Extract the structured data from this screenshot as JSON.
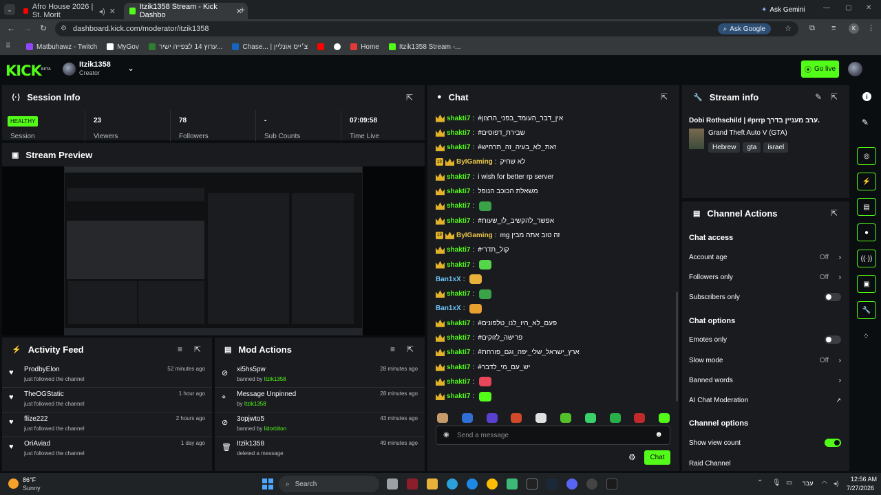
{
  "browser": {
    "tabs": [
      {
        "title": "Afro House 2026 | St. Morit"
      },
      {
        "title": "Itzik1358 Stream - Kick Dashbo"
      }
    ],
    "ask_gemini": "Ask Gemini",
    "url": "dashboard.kick.com/moderator/itzik1358",
    "ask_google": "Ask Google",
    "bookmarks": [
      {
        "label": "Matbuhawz - Twitch",
        "color": "#9146ff"
      },
      {
        "label": "MyGov",
        "color": ""
      },
      {
        "label": "ערוץ 14 לצפייה ישיר...",
        "color": "#2e7d32"
      },
      {
        "label": "Chase... | צ׳ייס אונליין",
        "color": "#1565c0"
      },
      {
        "label": "",
        "color": "#ff0000"
      },
      {
        "label": "",
        "color": "#ffffff"
      },
      {
        "label": "Home",
        "color": "#e53935"
      },
      {
        "label": "Itzik1358 Stream -...",
        "color": "#53fc18"
      }
    ],
    "profile_initial": "K"
  },
  "header": {
    "logo": "KICK",
    "logo_beta": "BETA",
    "channel_name": "Itzik1358",
    "role": "Creator",
    "go_live": "Go live"
  },
  "session": {
    "title": "Session Info",
    "health": "HEALTHY",
    "health_label": "Session",
    "stats": [
      {
        "value": "23",
        "label": "Viewers"
      },
      {
        "value": "78",
        "label": "Followers"
      },
      {
        "value": "-",
        "label": "Sub Counts"
      },
      {
        "value": "07:09:58",
        "label": "Time Live"
      }
    ]
  },
  "preview": {
    "title": "Stream Preview"
  },
  "activity": {
    "title": "Activity Feed",
    "items": [
      {
        "name": "ProdbyElon",
        "sub": "just followed the channel",
        "time": "52 minutes ago"
      },
      {
        "name": "TheOGStatic",
        "sub": "just followed the channel",
        "time": "1 hour ago"
      },
      {
        "name": "flize222",
        "sub": "just followed the channel",
        "time": "2 hours ago"
      },
      {
        "name": "OriAviad",
        "sub": "just followed the channel",
        "time": "1 day ago"
      }
    ]
  },
  "mod_actions": {
    "title": "Mod Actions",
    "items": [
      {
        "name": "xi5hs5pw",
        "sub_prefix": "banned by",
        "by": "Itzik1358",
        "time": "28 minutes ago",
        "icon": "ban-icon"
      },
      {
        "name": "Message Unpinned",
        "sub_prefix": "by",
        "by": "Itzik1358",
        "time": "28 minutes ago",
        "icon": "unpin-icon"
      },
      {
        "name": "3opjwto5",
        "sub_prefix": "banned by",
        "by": "lidorbiton",
        "time": "43 minutes ago",
        "icon": "ban-icon"
      },
      {
        "name": "Itzik1358",
        "sub_prefix": "deleted a message",
        "by": "",
        "time": "49 minutes ago",
        "icon": "trash-icon"
      }
    ]
  },
  "chat": {
    "title": "Chat",
    "messages": [
      {
        "user": "shakti7",
        "text": "#אין_דבר_העומד_בפני_הרצון",
        "kind": "crown",
        "color": "g"
      },
      {
        "user": "shakti7",
        "text": "#שבירת_דפוסים",
        "kind": "crown",
        "color": "g"
      },
      {
        "user": "shakti7",
        "text": "#זאת_לא_בעיה_זה_תרחיש",
        "kind": "crown",
        "color": "g"
      },
      {
        "user": "ByIGaming",
        "text": "לא שחיק",
        "kind": "sub",
        "color": "y"
      },
      {
        "user": "shakti7",
        "text": "i wish for better rp server",
        "kind": "crown",
        "color": "g"
      },
      {
        "user": "shakti7",
        "text": "משאלת הכוכב הנופל",
        "kind": "crown",
        "color": "g"
      },
      {
        "user": "shakti7",
        "text": "",
        "kind": "crown",
        "color": "g",
        "emote": "#3aa34a"
      },
      {
        "user": "shakti7",
        "text": "#אפשר_להקשיב_לו_שעות",
        "kind": "crown",
        "color": "g"
      },
      {
        "user": "ByIGaming",
        "text": "mg זה טוב אתה מבין",
        "kind": "sub",
        "color": "y"
      },
      {
        "user": "shakti7",
        "text": "#קול_תדרי",
        "kind": "crown",
        "color": "g"
      },
      {
        "user": "shakti7",
        "text": "",
        "kind": "crown",
        "color": "g",
        "emote": "#55d64a"
      },
      {
        "user": "Ban1xX",
        "text": "",
        "kind": "none",
        "color": "b",
        "emote": "#e8b23a"
      },
      {
        "user": "shakti7",
        "text": "",
        "kind": "crown",
        "color": "g",
        "emote": "#3aa34a"
      },
      {
        "user": "Ban1xX",
        "text": "",
        "kind": "none",
        "color": "b",
        "emote": "#e8a030"
      },
      {
        "user": "shakti7",
        "text": "#פעם_לא_היו_לנו_טלפונים",
        "kind": "crown",
        "color": "g"
      },
      {
        "user": "shakti7",
        "text": "#פרישה_לזוקים",
        "kind": "crown",
        "color": "g"
      },
      {
        "user": "shakti7",
        "text": "#ארץ_ישראל_שלי_יפה_וגם_פורחת",
        "kind": "crown",
        "color": "g"
      },
      {
        "user": "shakti7",
        "text": "#יש_עם_מי_לדבר",
        "kind": "crown",
        "color": "g"
      },
      {
        "user": "shakti7",
        "text": "",
        "kind": "crown",
        "color": "g",
        "emote": "#e8465a"
      },
      {
        "user": "shakti7",
        "text": "",
        "kind": "crown",
        "color": "g",
        "emote": "#53fc18"
      }
    ],
    "emote_bar": [
      "#c79a6a",
      "#2f6fd6",
      "#5b3fd0",
      "#d24a2a",
      "#e0e0e0",
      "#53c02a",
      "#3ad06a",
      "#2ab04a",
      "#c02a2a",
      "#53fc18"
    ],
    "input_placeholder": "Send a message",
    "send": "Chat"
  },
  "stream_info": {
    "title": "Stream info",
    "stream_title": "Dobi Rothschild | #prrp ערב מעניין בדרך.",
    "category": "Grand Theft Auto V (GTA)",
    "tags": [
      "Hebrew",
      "gta",
      "israel"
    ]
  },
  "channel_actions": {
    "title": "Channel Actions",
    "chat_access": "Chat access",
    "account_age": {
      "label": "Account age",
      "value": "Off"
    },
    "followers_only": {
      "label": "Followers only",
      "value": "Off"
    },
    "subscribers_only": {
      "label": "Subscribers only",
      "on": false
    },
    "chat_options": "Chat options",
    "emotes_only": {
      "label": "Emotes only",
      "on": false
    },
    "slow_mode": {
      "label": "Slow mode",
      "value": "Off"
    },
    "banned_words": {
      "label": "Banned words"
    },
    "ai_moderation": {
      "label": "AI Chat Moderation"
    },
    "channel_options": "Channel options",
    "show_view_count": {
      "label": "Show view count",
      "on": true
    },
    "raid_channel": {
      "label": "Raid Channel"
    }
  },
  "taskbar": {
    "weather_temp": "86°F",
    "weather_desc": "Sunny",
    "search": "Search",
    "lang": "עבר",
    "time": "12:56 AM",
    "date": "7/27/2026"
  }
}
